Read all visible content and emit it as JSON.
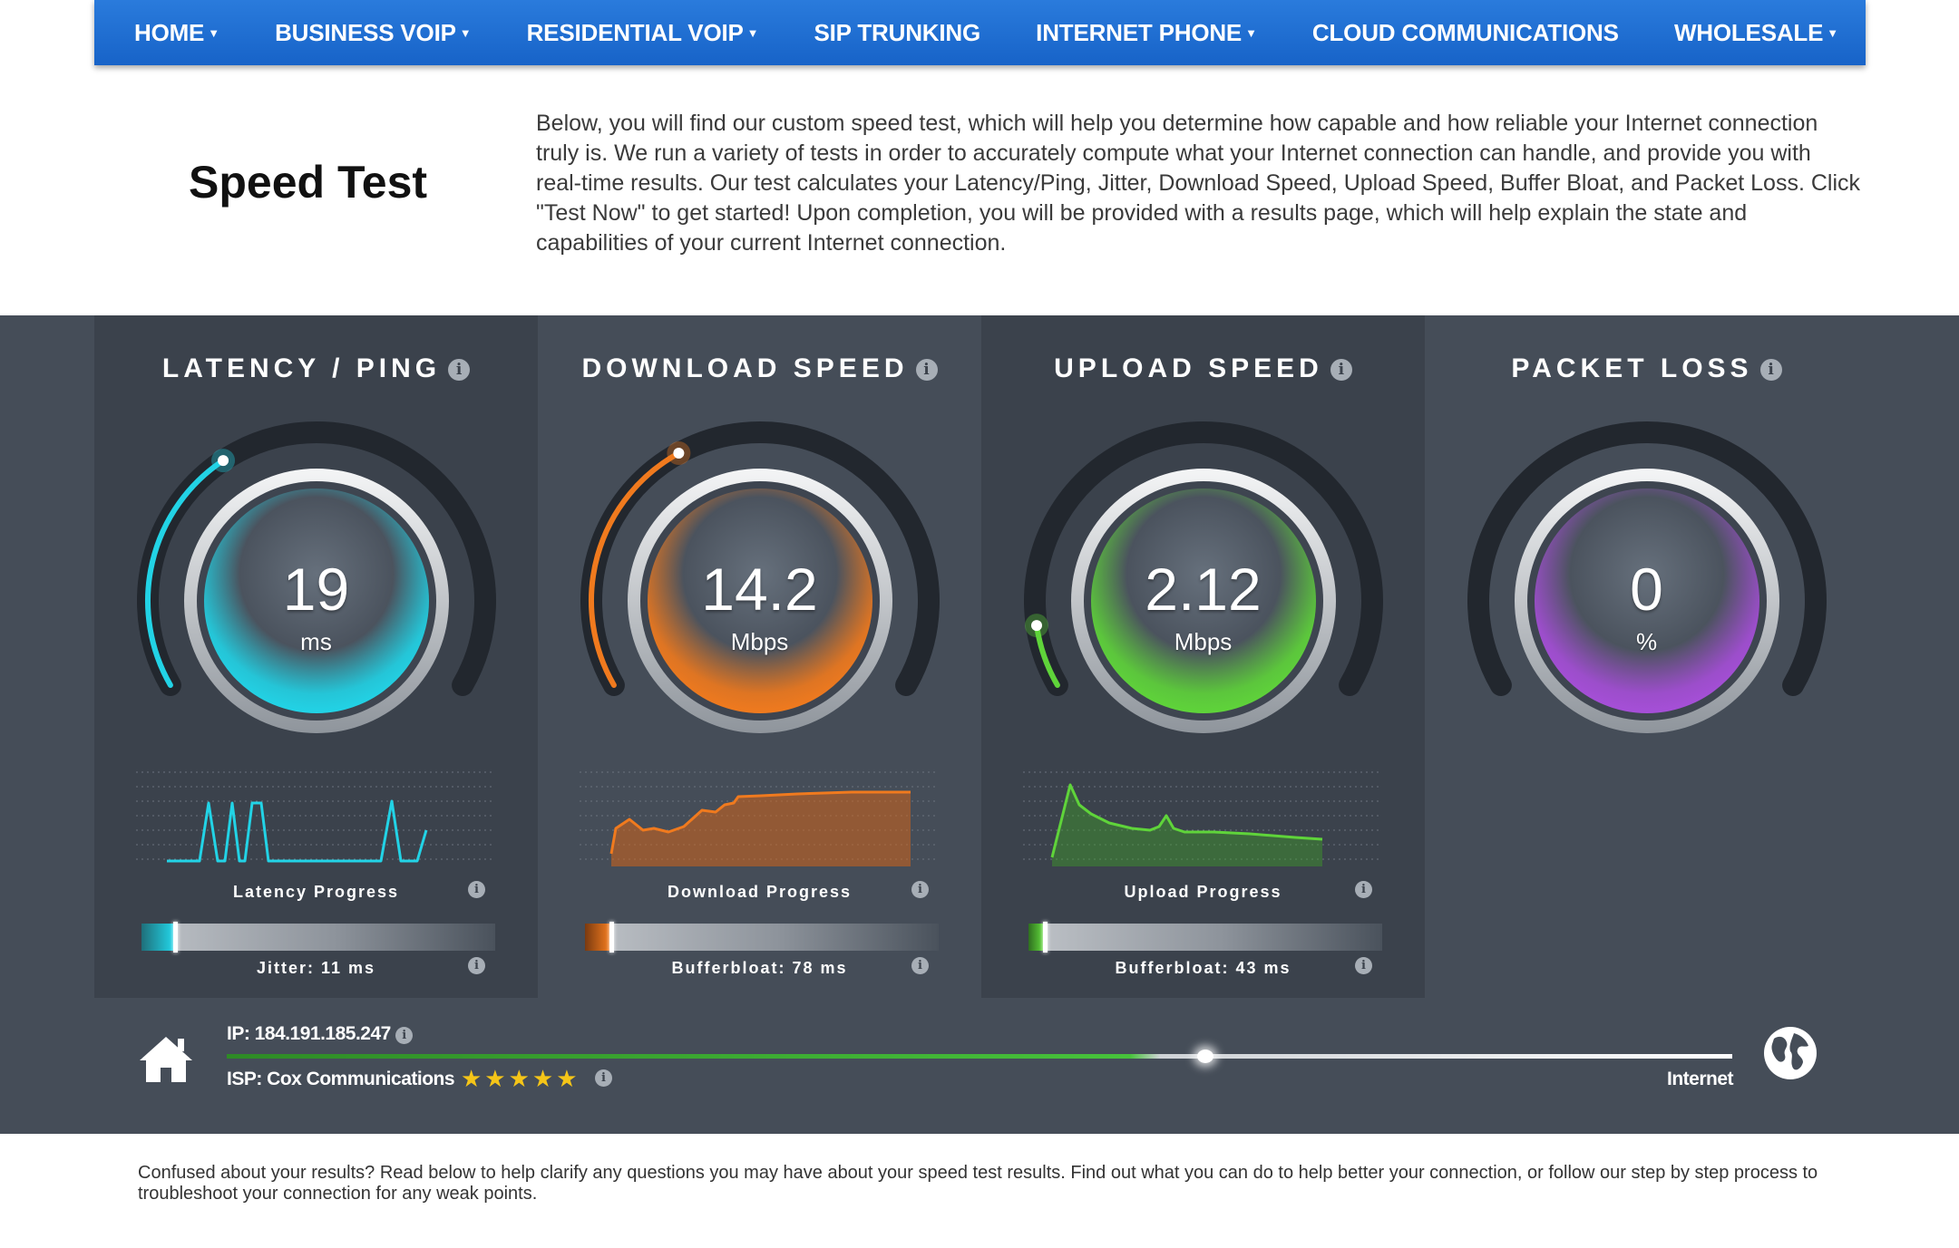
{
  "nav": {
    "items": [
      {
        "label": "HOME",
        "dropdown": true
      },
      {
        "label": "BUSINESS VOIP",
        "dropdown": true
      },
      {
        "label": "RESIDENTIAL VOIP",
        "dropdown": true
      },
      {
        "label": "SIP TRUNKING",
        "dropdown": false
      },
      {
        "label": "INTERNET PHONE",
        "dropdown": true
      },
      {
        "label": "CLOUD COMMUNICATIONS",
        "dropdown": false
      },
      {
        "label": "WHOLESALE",
        "dropdown": true
      }
    ]
  },
  "page": {
    "title": "Speed Test",
    "intro": "Below, you will find our custom speed test, which will help you determine how capable and how reliable your Internet connection truly is. We run a variety of tests in order to accurately compute what your Internet connection can handle, and provide you with real-time results. Our test calculates your Latency/Ping, Jitter, Download Speed, Upload Speed, Buffer Bloat, and Packet Loss. Click \"Test Now\" to get started! Upon completion, you will be provided with a results page, which will help explain the state and capabilities of your current Internet connection."
  },
  "metrics": {
    "latency": {
      "title": "LATENCY / PING",
      "value": "19",
      "unit": "ms",
      "progress_label": "Latency Progress",
      "bar_label": "Jitter: 11 ms",
      "gauge_fraction": 0.36,
      "bar_fraction": 0.09,
      "color": "#22d3e6"
    },
    "download": {
      "title": "DOWNLOAD SPEED",
      "value": "14.2",
      "unit": "Mbps",
      "progress_label": "Download Progress",
      "bar_label": "Bufferbloat: 78 ms",
      "gauge_fraction": 0.38,
      "bar_fraction": 0.07,
      "color": "#f07a1e"
    },
    "upload": {
      "title": "UPLOAD SPEED",
      "value": "2.12",
      "unit": "Mbps",
      "progress_label": "Upload Progress",
      "bar_label": "Bufferbloat: 43 ms",
      "gauge_fraction": 0.09,
      "bar_fraction": 0.04,
      "color": "#5fd43a"
    },
    "packet_loss": {
      "title": "PACKET LOSS",
      "value": "0",
      "unit": "%",
      "gauge_fraction": 0,
      "color": "#a64fd8"
    }
  },
  "connection": {
    "ip": "IP: 184.191.185.247",
    "isp": "ISP: Cox Communications",
    "stars": "★★★★★",
    "rating": 5,
    "internet_label": "Internet",
    "progress_fraction": 0.65,
    "accent": "#47c23b"
  },
  "footer": {
    "text": "Confused about your results? Read below to help clarify any questions you may have about your speed test results. Find out what you can do to help better your connection, or follow our step by step process to troubleshoot your connection for any weak points."
  }
}
